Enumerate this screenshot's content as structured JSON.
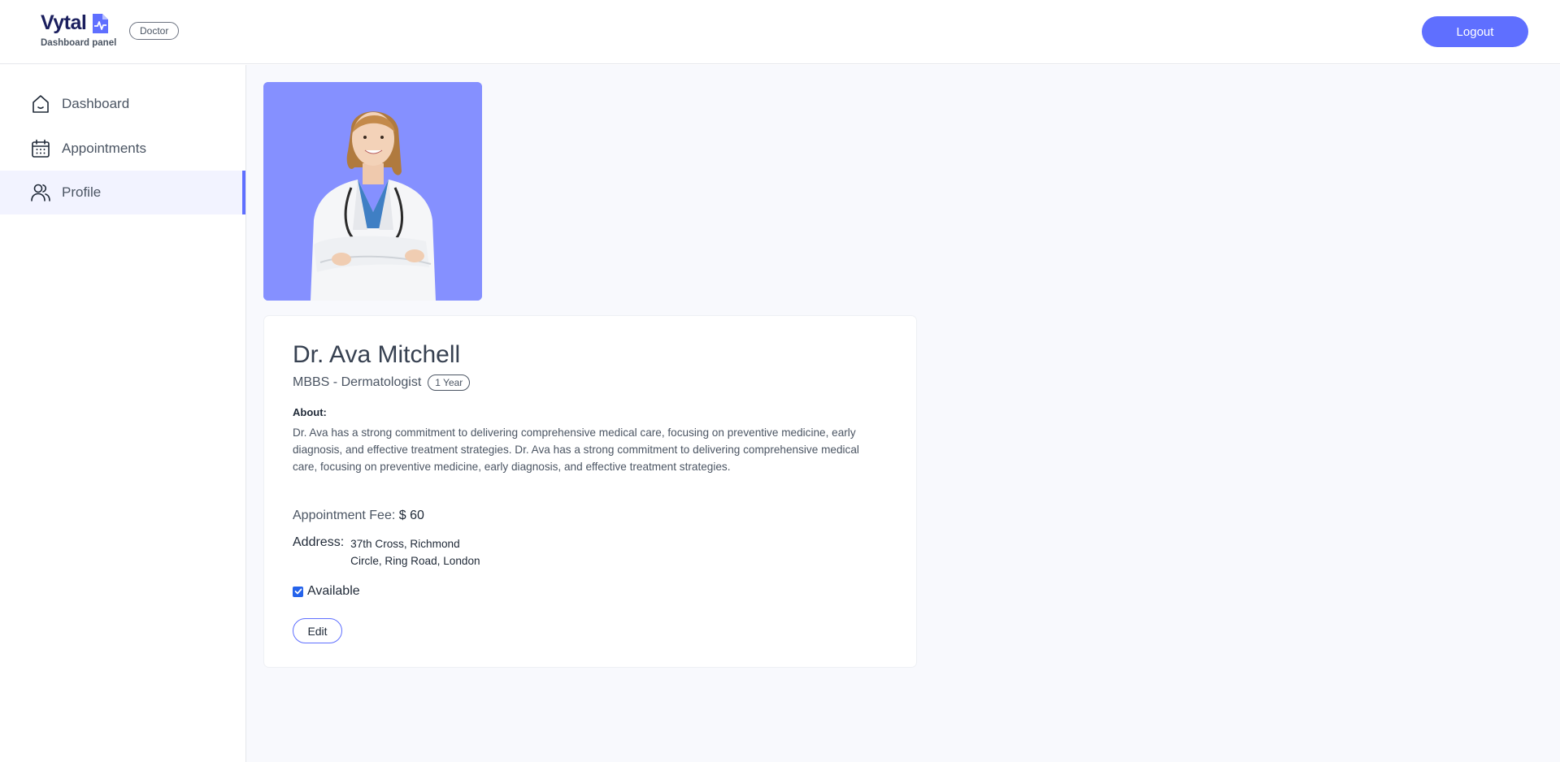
{
  "header": {
    "brand_name": "Vytal",
    "brand_subtitle": "Dashboard panel",
    "role_badge": "Doctor",
    "logout_label": "Logout"
  },
  "sidebar": {
    "items": [
      {
        "label": "Dashboard",
        "icon": "home-icon",
        "active": false
      },
      {
        "label": "Appointments",
        "icon": "calendar-icon",
        "active": false
      },
      {
        "label": "Profile",
        "icon": "people-icon",
        "active": true
      }
    ]
  },
  "profile": {
    "name": "Dr. Ava Mitchell",
    "degree": "MBBS - Dermatologist",
    "experience": "1 Year",
    "about_label": "About:",
    "about_text": "Dr. Ava has a strong commitment to delivering comprehensive medical care, focusing on preventive medicine, early diagnosis, and effective treatment strategies. Dr. Ava has a strong commitment to delivering comprehensive medical care, focusing on preventive medicine, early diagnosis, and effective treatment strategies.",
    "fee_label": "Appointment Fee:",
    "fee_value": "$ 60",
    "address_label": "Address:",
    "address_line1": "37th Cross, Richmond",
    "address_line2": "Circle, Ring Road, London",
    "available_label": "Available",
    "available": true,
    "edit_label": "Edit"
  },
  "colors": {
    "primary": "#5f6fff",
    "photo_bg": "#8590ff",
    "active_nav_bg": "#f2f3ff",
    "main_bg": "#f8f9fd"
  }
}
